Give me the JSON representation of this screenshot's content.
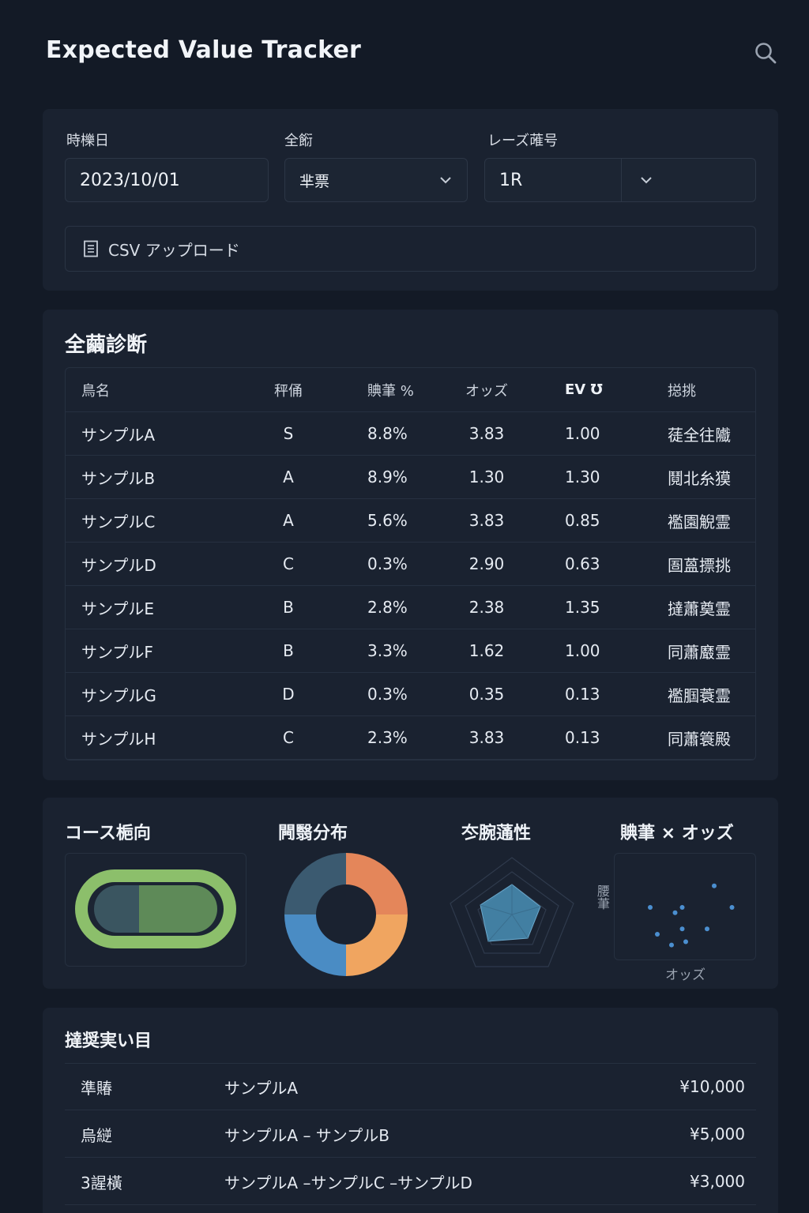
{
  "header": {
    "title": "Expected Value Tracker",
    "search_icon": "search-icon"
  },
  "filters": {
    "date_label": "時櫟日",
    "date_value": "2023/10/01",
    "venue_label": "全餰",
    "venue_value": "芈票",
    "race_label": "レーズ蓶号",
    "race_value": "1R",
    "upload_label": "CSV アップロード",
    "upload_icon": "file-icon"
  },
  "diagnosis": {
    "title": "全繭診断",
    "columns": [
      "鳥名",
      "秤俑",
      "賟茟 %",
      "オッズ",
      "EV Ʊ",
      "搃挑"
    ],
    "rows": [
      {
        "name": "サンプルA",
        "grade": "S",
        "win": "8.8%",
        "odds": "3.83",
        "ev": "1.00",
        "judge": "蓗全往隵"
      },
      {
        "name": "サンプルB",
        "grade": "A",
        "win": "8.9%",
        "odds": "1.30",
        "ev": "1.30",
        "judge": "鬩北糸獏"
      },
      {
        "name": "サンプルC",
        "grade": "A",
        "win": "5.6%",
        "odds": "3.83",
        "ev": "0.85",
        "judge": "襤園觬霊"
      },
      {
        "name": "サンプルD",
        "grade": "C",
        "win": "0.3%",
        "odds": "2.90",
        "ev": "0.63",
        "judge": "圄蒕摽挑"
      },
      {
        "name": "サンプルE",
        "grade": "B",
        "win": "2.8%",
        "odds": "2.38",
        "ev": "1.35",
        "judge": "撻蕭奠霊"
      },
      {
        "name": "サンプルF",
        "grade": "B",
        "win": "3.3%",
        "odds": "1.62",
        "ev": "1.00",
        "judge": "同蕭黀霊"
      },
      {
        "name": "サンプルG",
        "grade": "D",
        "win": "0.3%",
        "odds": "0.35",
        "ev": "0.13",
        "judge": "襤腘蓑霊"
      },
      {
        "name": "サンプルH",
        "grade": "C",
        "win": "2.3%",
        "odds": "3.83",
        "ev": "0.13",
        "judge": "同蕭簑殿"
      }
    ]
  },
  "charts": {
    "course_title": "コース梔向",
    "dist_title": "闁翳分布",
    "radar_title": "冭腕蓪性",
    "scatter_title": "賟茟 × オッズ",
    "scatter_xlabel": "オッズ",
    "scatter_ylabel": "腰茟",
    "colors": {
      "track_outer": "#8cbf6b",
      "track_left": "#3a5560",
      "track_right": "#5e8a58",
      "donut": [
        "#e4865a",
        "#f0a560",
        "#4a8cc4",
        "#3b5a70"
      ],
      "radar_fill": "#4a8fb6",
      "dot": "#4b8fd0"
    }
  },
  "chart_data": [
    {
      "type": "pie",
      "title": "闁翳分布",
      "values": [
        25,
        25,
        25,
        25
      ]
    },
    {
      "type": "scatter",
      "title": "賟茟 × オッズ",
      "xlabel": "オッズ",
      "ylabel": "腰茟",
      "x": [
        0.5,
        0.6,
        0.8,
        0.85,
        0.95,
        0.95,
        1.0,
        1.3,
        1.4,
        1.65
      ],
      "y": [
        0.5,
        0.25,
        0.15,
        0.45,
        0.5,
        0.3,
        0.18,
        0.3,
        0.7,
        0.5
      ],
      "xlim": [
        0,
        2
      ],
      "ylim": [
        0,
        1
      ]
    }
  ],
  "bets": {
    "title": "撻奨実い目",
    "rows": [
      {
        "type": "準賰",
        "combo": "サンプルA",
        "amount": "¥10,000"
      },
      {
        "type": "烏縌",
        "combo": "サンプルA – サンプルB",
        "amount": "¥5,000"
      },
      {
        "type": "3謃橫",
        "combo": "サンプルA –サンプルC –サンプルD",
        "amount": "¥3,000"
      }
    ]
  }
}
